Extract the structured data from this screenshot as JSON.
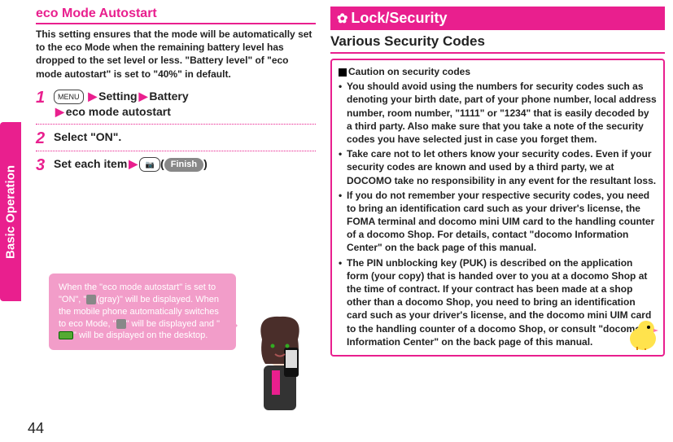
{
  "sideTab": "Basic Operation",
  "pageNumber": "44",
  "left": {
    "title": "eco Mode Autostart",
    "description": "This setting ensures that the mode will be automatically set to the eco Mode when the remaining battery level has dropped to the set level or less.\n\"Battery level\" of \"eco mode autostart\" is set to \"40%\" in default.",
    "steps": {
      "s1": {
        "num": "1",
        "menuKey": "MENU",
        "part1": "Setting",
        "part2": "Battery",
        "part3": "eco mode autostart"
      },
      "s2": {
        "num": "2",
        "text": "Select \"ON\"."
      },
      "s3": {
        "num": "3",
        "text": "Set each item",
        "camKey": "📷",
        "finish": "Finish"
      }
    },
    "callout": {
      "l1": "When the \"eco mode autostart\" is set to \"ON\", \"",
      "l1b": "(gray)\" will be displayed.",
      "l2": "When the mobile phone automatically switches to eco Mode, \"",
      "l2b": "\" will be displayed and \"",
      "l2c": "\" will be displayed on the desktop."
    }
  },
  "right": {
    "header": "Lock/Security",
    "subheader": "Various Security Codes",
    "cautionTitle": "Caution on security codes",
    "bullets": [
      "You should avoid using the numbers for security codes such as denoting your birth date, part of your phone number, local address number, room number, \"1111\" or \"1234\" that is easily decoded by a third party. Also make sure that you take a note of the security codes you have selected just in case you forget them.",
      "Take care not to let others know your security codes. Even if your security codes are known and used by a third party, we at DOCOMO take no responsibility in any event for the resultant loss.",
      "If you do not remember your respective security codes, you need to bring an identification card such as your driver's license, the FOMA terminal and docomo mini UIM card to the handling counter of a docomo Shop. For details, contact \"docomo Information Center\" on the back page of this manual.",
      "The PIN unblocking key (PUK) is described on the application form (your copy) that is handed over to you at a docomo Shop at the time of contract. If your contract has been made at a shop other than a docomo Shop, you need to bring an identification card such as your driver's license, and the docomo mini UIM card to the handling counter of a docomo Shop, or consult \"docomo Information Center\" on the back page of this manual."
    ]
  }
}
